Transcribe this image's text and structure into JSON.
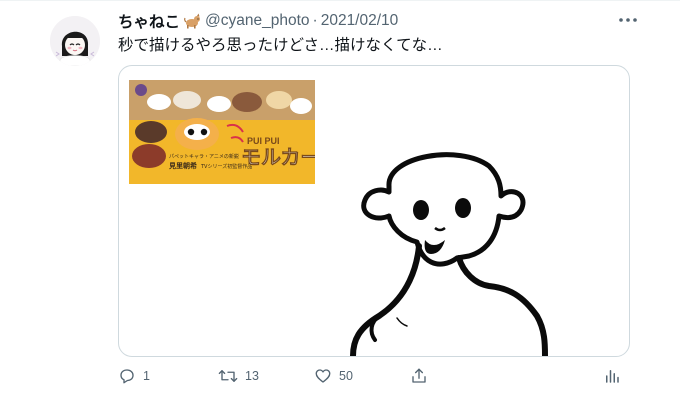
{
  "tweet": {
    "display_name": "ちゃねこ",
    "name_emoji": "dog-emoji",
    "handle": "@cyane_photo",
    "separator": "·",
    "date": "2021/02/10",
    "text": "秒で描けるやろ思ったけどさ…描けなくてな…"
  },
  "media": {
    "promo": {
      "title": "モルカー",
      "title_prefix": "PUI PUI",
      "caption_1": "パペットキャラ・アニメの新鋭",
      "caption_2": "見里朝希",
      "caption_3": "TVシリーズ初監督作品"
    }
  },
  "actions": {
    "reply_count": "1",
    "retweet_count": "13",
    "like_count": "50"
  },
  "colors": {
    "text": "#0f1419",
    "muted": "#536471",
    "border": "#cfd9de",
    "promo_yellow": "#f2b72a"
  }
}
